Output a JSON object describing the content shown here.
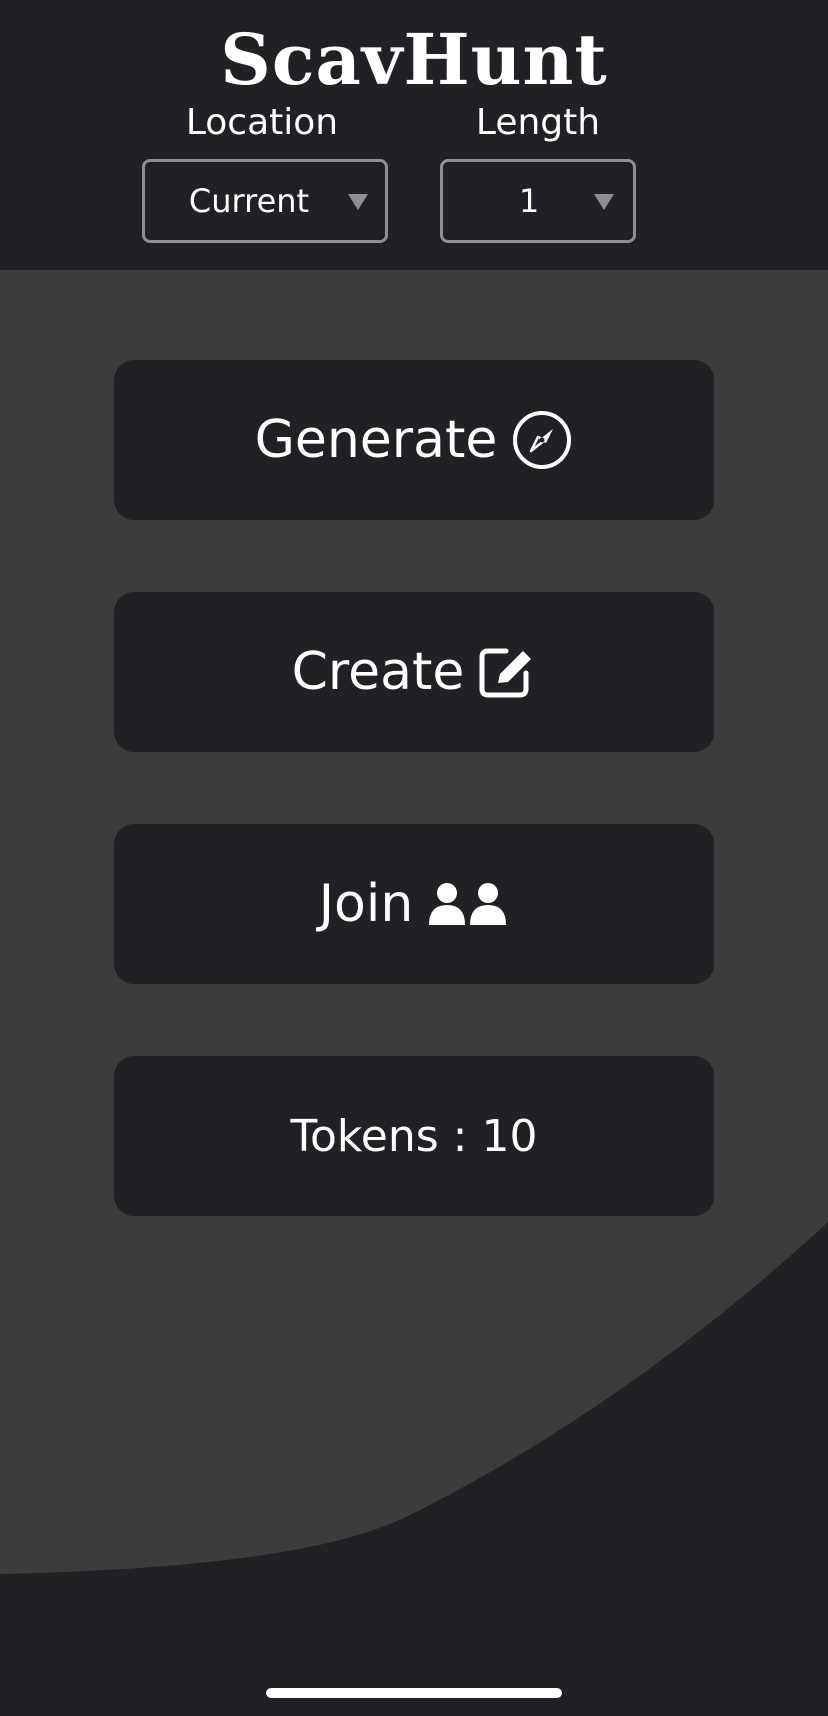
{
  "app": {
    "title": "ScavHunt"
  },
  "filters": {
    "location": {
      "label": "Location",
      "value": "Current"
    },
    "length": {
      "label": "Length",
      "value": "1"
    }
  },
  "actions": {
    "generate": {
      "label": "Generate",
      "icon": "compass-icon"
    },
    "create": {
      "label": "Create",
      "icon": "edit-icon"
    },
    "join": {
      "label": "Join",
      "icon": "users-icon"
    },
    "tokens": {
      "label": "Tokens : 10"
    }
  },
  "colors": {
    "background_dark": "#202124",
    "background_panel": "#3c3c3c",
    "select_border": "#8e8e93",
    "text": "#ffffff"
  }
}
